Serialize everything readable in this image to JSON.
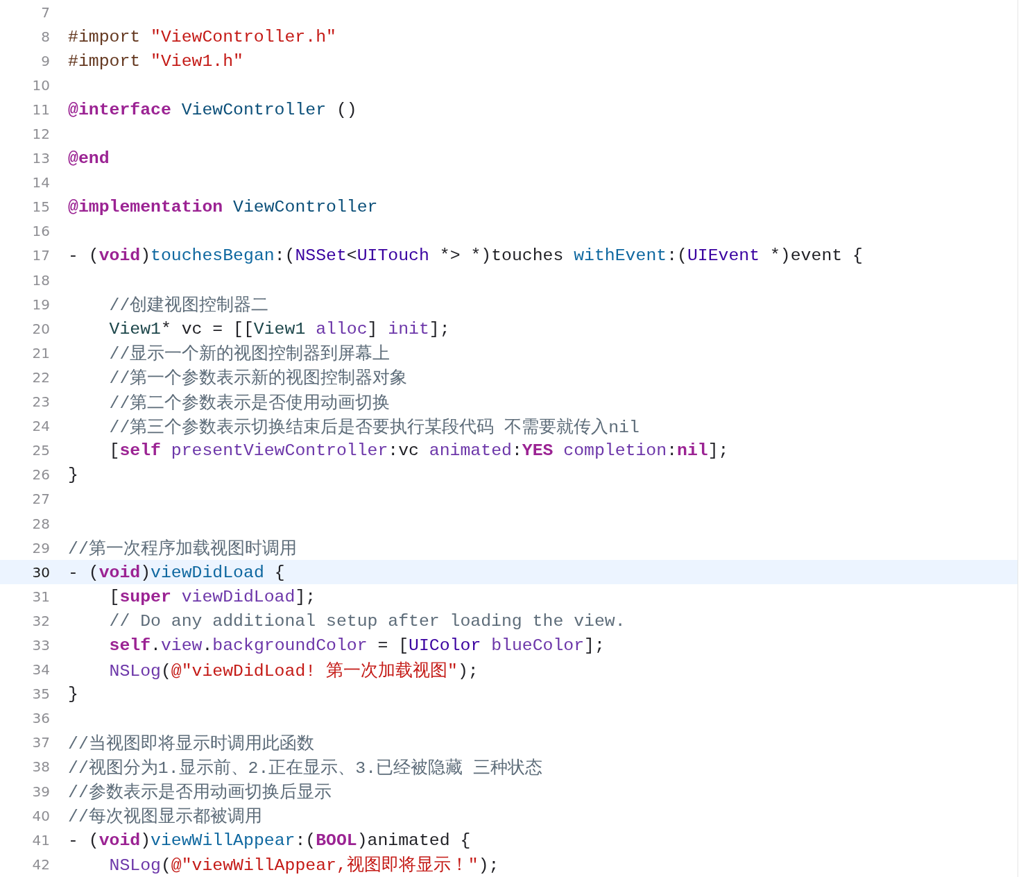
{
  "editor": {
    "lines": [
      {
        "number": "7",
        "selected": false
      },
      {
        "number": "8",
        "selected": false,
        "tokens": [
          {
            "text": "#import ",
            "kind": "preproc"
          },
          {
            "text": "\"ViewController.h\"",
            "kind": "string"
          }
        ]
      },
      {
        "number": "9",
        "selected": false,
        "tokens": [
          {
            "text": "#import ",
            "kind": "preproc"
          },
          {
            "text": "\"View1.h\"",
            "kind": "string"
          }
        ]
      },
      {
        "number": "10",
        "selected": false
      },
      {
        "number": "11",
        "selected": false,
        "tokens": [
          {
            "text": "@interface",
            "kind": "keyword"
          },
          {
            "text": " ViewController",
            "kind": "decl"
          },
          {
            "text": " ()",
            "kind": "plain"
          }
        ]
      },
      {
        "number": "12",
        "selected": false
      },
      {
        "number": "13",
        "selected": false,
        "tokens": [
          {
            "text": "@end",
            "kind": "keyword"
          }
        ]
      },
      {
        "number": "14",
        "selected": false
      },
      {
        "number": "15",
        "selected": false,
        "tokens": [
          {
            "text": "@implementation",
            "kind": "keyword"
          },
          {
            "text": " ViewController",
            "kind": "decl"
          }
        ]
      },
      {
        "number": "16",
        "selected": false
      },
      {
        "number": "17",
        "selected": false,
        "tokens": [
          {
            "text": "- (",
            "kind": "plain"
          },
          {
            "text": "void",
            "kind": "keyword"
          },
          {
            "text": ")",
            "kind": "plain"
          },
          {
            "text": "touchesBegan",
            "kind": "method_decl"
          },
          {
            "text": ":(",
            "kind": "plain"
          },
          {
            "text": "NSSet",
            "kind": "system_type"
          },
          {
            "text": "<",
            "kind": "plain"
          },
          {
            "text": "UITouch",
            "kind": "system_type"
          },
          {
            "text": " *> *)touches ",
            "kind": "plain"
          },
          {
            "text": "withEvent",
            "kind": "method_decl"
          },
          {
            "text": ":(",
            "kind": "plain"
          },
          {
            "text": "UIEvent",
            "kind": "system_type"
          },
          {
            "text": " *)event {",
            "kind": "plain"
          }
        ]
      },
      {
        "number": "18",
        "selected": false
      },
      {
        "number": "19",
        "selected": false,
        "indent": true,
        "tokens": [
          {
            "text": "//创建视图控制器二",
            "kind": "comment"
          }
        ]
      },
      {
        "number": "20",
        "selected": false,
        "indent": true,
        "tokens": [
          {
            "text": "View1",
            "kind": "project_type"
          },
          {
            "text": "* vc = [[",
            "kind": "plain"
          },
          {
            "text": "View1",
            "kind": "project_type"
          },
          {
            "text": " alloc",
            "kind": "system_method"
          },
          {
            "text": "] ",
            "kind": "plain"
          },
          {
            "text": "init",
            "kind": "system_method"
          },
          {
            "text": "];",
            "kind": "plain"
          }
        ]
      },
      {
        "number": "21",
        "selected": false,
        "indent": true,
        "tokens": [
          {
            "text": "//显示一个新的视图控制器到屏幕上",
            "kind": "comment"
          }
        ]
      },
      {
        "number": "22",
        "selected": false,
        "indent": true,
        "tokens": [
          {
            "text": "//第一个参数表示新的视图控制器对象",
            "kind": "comment"
          }
        ]
      },
      {
        "number": "23",
        "selected": false,
        "indent": true,
        "tokens": [
          {
            "text": "//第二个参数表示是否使用动画切换",
            "kind": "comment"
          }
        ]
      },
      {
        "number": "24",
        "selected": false,
        "indent": true,
        "tokens": [
          {
            "text": "//第三个参数表示切换结束后是否要执行某段代码 不需要就传入nil",
            "kind": "comment"
          }
        ]
      },
      {
        "number": "25",
        "selected": false,
        "indent": true,
        "tokens": [
          {
            "text": "[",
            "kind": "plain"
          },
          {
            "text": "self",
            "kind": "keyword"
          },
          {
            "text": " presentViewController",
            "kind": "system_method"
          },
          {
            "text": ":vc ",
            "kind": "plain"
          },
          {
            "text": "animated",
            "kind": "system_method"
          },
          {
            "text": ":",
            "kind": "plain"
          },
          {
            "text": "YES",
            "kind": "keyword"
          },
          {
            "text": " completion",
            "kind": "system_method"
          },
          {
            "text": ":",
            "kind": "plain"
          },
          {
            "text": "nil",
            "kind": "keyword"
          },
          {
            "text": "];",
            "kind": "plain"
          }
        ]
      },
      {
        "number": "26",
        "selected": false,
        "tokens": [
          {
            "text": "}",
            "kind": "plain"
          }
        ]
      },
      {
        "number": "27",
        "selected": false
      },
      {
        "number": "28",
        "selected": false
      },
      {
        "number": "29",
        "selected": false,
        "tokens": [
          {
            "text": "//第一次程序加载视图时调用",
            "kind": "comment"
          }
        ]
      },
      {
        "number": "30",
        "selected": true,
        "tokens": [
          {
            "text": "- (",
            "kind": "plain"
          },
          {
            "text": "void",
            "kind": "keyword"
          },
          {
            "text": ")",
            "kind": "plain"
          },
          {
            "text": "viewDidLoad",
            "kind": "method_decl"
          },
          {
            "text": " {",
            "kind": "plain"
          }
        ]
      },
      {
        "number": "31",
        "selected": false,
        "indent": true,
        "tokens": [
          {
            "text": "[",
            "kind": "plain"
          },
          {
            "text": "super",
            "kind": "keyword"
          },
          {
            "text": " viewDidLoad",
            "kind": "system_method"
          },
          {
            "text": "];",
            "kind": "plain"
          }
        ]
      },
      {
        "number": "32",
        "selected": false,
        "indent": true,
        "tokens": [
          {
            "text": "// Do any additional setup after loading the view.",
            "kind": "comment"
          }
        ]
      },
      {
        "number": "33",
        "selected": false,
        "indent": true,
        "tokens": [
          {
            "text": "self",
            "kind": "keyword"
          },
          {
            "text": ".",
            "kind": "plain"
          },
          {
            "text": "view",
            "kind": "system_method"
          },
          {
            "text": ".",
            "kind": "plain"
          },
          {
            "text": "backgroundColor",
            "kind": "system_method"
          },
          {
            "text": " = [",
            "kind": "plain"
          },
          {
            "text": "UIColor",
            "kind": "system_type"
          },
          {
            "text": " blueColor",
            "kind": "system_method"
          },
          {
            "text": "];",
            "kind": "plain"
          }
        ]
      },
      {
        "number": "34",
        "selected": false,
        "indent": true,
        "tokens": [
          {
            "text": "NSLog",
            "kind": "system_method"
          },
          {
            "text": "(",
            "kind": "plain"
          },
          {
            "text": "@\"viewDidLoad! 第一次加载视图\"",
            "kind": "string"
          },
          {
            "text": ");",
            "kind": "plain"
          }
        ]
      },
      {
        "number": "35",
        "selected": false,
        "tokens": [
          {
            "text": "}",
            "kind": "plain"
          }
        ]
      },
      {
        "number": "36",
        "selected": false
      },
      {
        "number": "37",
        "selected": false,
        "tokens": [
          {
            "text": "//当视图即将显示时调用此函数",
            "kind": "comment"
          }
        ]
      },
      {
        "number": "38",
        "selected": false,
        "tokens": [
          {
            "text": "//视图分为1.显示前、2.正在显示、3.已经被隐藏 三种状态",
            "kind": "comment"
          }
        ]
      },
      {
        "number": "39",
        "selected": false,
        "tokens": [
          {
            "text": "//参数表示是否用动画切换后显示",
            "kind": "comment"
          }
        ]
      },
      {
        "number": "40",
        "selected": false,
        "tokens": [
          {
            "text": "//每次视图显示都被调用",
            "kind": "comment"
          }
        ]
      },
      {
        "number": "41",
        "selected": false,
        "tokens": [
          {
            "text": "- (",
            "kind": "plain"
          },
          {
            "text": "void",
            "kind": "keyword"
          },
          {
            "text": ")",
            "kind": "plain"
          },
          {
            "text": "viewWillAppear",
            "kind": "method_decl"
          },
          {
            "text": ":(",
            "kind": "plain"
          },
          {
            "text": "BOOL",
            "kind": "keyword"
          },
          {
            "text": ")animated {",
            "kind": "plain"
          }
        ]
      },
      {
        "number": "42",
        "selected": false,
        "indent": true,
        "tokens": [
          {
            "text": "NSLog",
            "kind": "system_method"
          },
          {
            "text": "(",
            "kind": "plain"
          },
          {
            "text": "@\"viewWillAppear,视图即将显示！\"",
            "kind": "string"
          },
          {
            "text": ");",
            "kind": "plain"
          }
        ]
      }
    ]
  }
}
